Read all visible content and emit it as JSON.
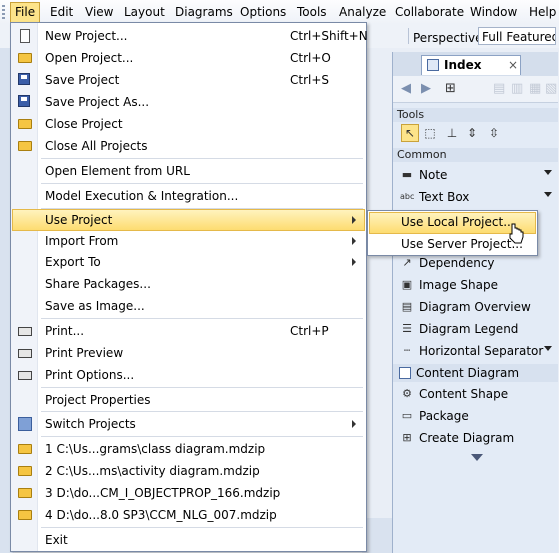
{
  "menubar": {
    "items": [
      "File",
      "Edit",
      "View",
      "Layout",
      "Diagrams",
      "Options",
      "Tools",
      "Analyze",
      "Collaborate",
      "Window",
      "Help"
    ]
  },
  "perspective": {
    "label": "Perspective:",
    "value": "Full Featured"
  },
  "palette": {
    "tab_label": "Index",
    "tab_close": "×",
    "sections": {
      "tools": "Tools",
      "common": "Common"
    },
    "items": [
      {
        "label": "Note",
        "icon": "note-icon",
        "glyph": "▬",
        "arrow": true
      },
      {
        "label": "Text Box",
        "icon": "text-box-icon",
        "glyph": "abc",
        "arrow": true
      },
      {
        "label": "Dependency",
        "icon": "dependency-icon",
        "glyph": "↗",
        "arrow": false
      },
      {
        "label": "Image Shape",
        "icon": "image-shape-icon",
        "glyph": "▣",
        "arrow": false
      },
      {
        "label": "Diagram Overview",
        "icon": "diagram-overview-icon",
        "glyph": "▤",
        "arrow": false
      },
      {
        "label": "Diagram Legend",
        "icon": "diagram-legend-icon",
        "glyph": "☰",
        "arrow": false
      },
      {
        "label": "Horizontal Separator",
        "icon": "horizontal-separator-icon",
        "glyph": "┄",
        "arrow": true
      }
    ],
    "group": "Content Diagram",
    "group_items": [
      {
        "label": "Content Shape",
        "icon": "content-shape-icon",
        "glyph": "⚙"
      },
      {
        "label": "Package",
        "icon": "package-icon",
        "glyph": "▭"
      },
      {
        "label": "Create Diagram",
        "icon": "create-diagram-icon",
        "glyph": "⊞"
      }
    ]
  },
  "file_menu": {
    "new_project": "New Project...",
    "new_project_sc": "Ctrl+Shift+N",
    "open_project": "Open Project...",
    "open_project_sc": "Ctrl+O",
    "save_project": "Save Project",
    "save_project_sc": "Ctrl+S",
    "save_project_as": "Save Project As...",
    "close_project": "Close Project",
    "close_all_projects": "Close All Projects",
    "open_element_from_url": "Open Element from URL",
    "model_execution": "Model Execution & Integration...",
    "use_project": "Use Project",
    "import_from": "Import From",
    "export_to": "Export To",
    "share_packages": "Share Packages...",
    "save_as_image": "Save as Image...",
    "print": "Print...",
    "print_sc": "Ctrl+P",
    "print_preview": "Print Preview",
    "print_options": "Print Options...",
    "project_properties": "Project Properties",
    "switch_projects": "Switch Projects",
    "recent": [
      "1 C:\\Us...grams\\class diagram.mdzip",
      "2 C:\\Us...ms\\activity diagram.mdzip",
      "3 D:\\do...CM_I_OBJECTPROP_166.mdzip",
      "4 D:\\do...8.0 SP3\\CCM_NLG_007.mdzip"
    ],
    "exit": "Exit"
  },
  "use_project_submenu": {
    "use_local": "Use Local Project...",
    "use_server": "Use Server Project..."
  }
}
